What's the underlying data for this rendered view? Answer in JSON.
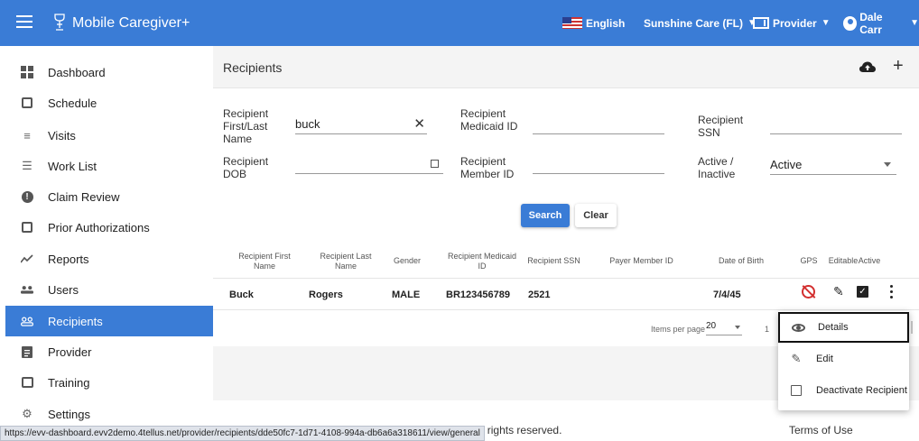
{
  "app": {
    "title": "Mobile Caregiver+",
    "language": "English",
    "agency": "Sunshine Care (FL)",
    "role": "Provider",
    "user": "Dale Carr"
  },
  "sidebar": {
    "items": [
      {
        "label": "Dashboard",
        "icon": "dashboard-icon"
      },
      {
        "label": "Schedule",
        "icon": "calendar-icon"
      },
      {
        "label": "Visits",
        "icon": "filter-icon"
      },
      {
        "label": "Work List",
        "icon": "list-icon"
      },
      {
        "label": "Claim Review",
        "icon": "alert-icon"
      },
      {
        "label": "Prior Authorizations",
        "icon": "calendar-day-icon"
      },
      {
        "label": "Reports",
        "icon": "trend-icon"
      },
      {
        "label": "Users",
        "icon": "users-icon"
      },
      {
        "label": "Recipients",
        "icon": "recipients-icon",
        "active": true
      },
      {
        "label": "Provider",
        "icon": "clipboard-icon"
      },
      {
        "label": "Training",
        "icon": "training-icon"
      },
      {
        "label": "Settings",
        "icon": "gear-icon"
      }
    ]
  },
  "page": {
    "title": "Recipients"
  },
  "filters": {
    "name_label": "Recipient First/Last Name",
    "name_value": "buck",
    "medicaid_label": "Recipient Medicaid ID",
    "medicaid_value": "",
    "ssn_label": "Recipient SSN",
    "ssn_value": "",
    "dob_label": "Recipient DOB",
    "dob_value": "",
    "member_label": "Recipient Member ID",
    "member_value": "",
    "status_label": "Active / Inactive",
    "status_value": "Active",
    "search_button": "Search",
    "clear_button": "Clear"
  },
  "table": {
    "headers": [
      "Recipient First Name",
      "Recipient Last Name",
      "Gender",
      "Recipient Medicaid ID",
      "Recipient SSN",
      "Payer Member ID",
      "Date of Birth",
      "GPS",
      "Editable",
      "Active"
    ],
    "rows": [
      {
        "first": "Buck",
        "last": "Rogers",
        "gender": "MALE",
        "medicaid": "BR123456789",
        "ssn": "2521",
        "member": "",
        "dob": "7/4/45"
      }
    ]
  },
  "pager": {
    "label": "Items per page",
    "per_page": "20",
    "range": "1"
  },
  "menu": {
    "items": [
      "Details",
      "Edit",
      "Deactivate Recipient"
    ]
  },
  "footer": {
    "copyright": "hnologies, Inc. All rights reserved.",
    "terms": "Terms of Use",
    "status_url": "https://evv-dashboard.evv2demo.4tellus.net/provider/recipients/dde50fc7-1d71-4108-994a-db6a6a318611/view/general"
  },
  "colors": {
    "primary": "#3a7cd6",
    "header_bg": "#f4f4f4",
    "gps_error": "#d32f2f"
  }
}
